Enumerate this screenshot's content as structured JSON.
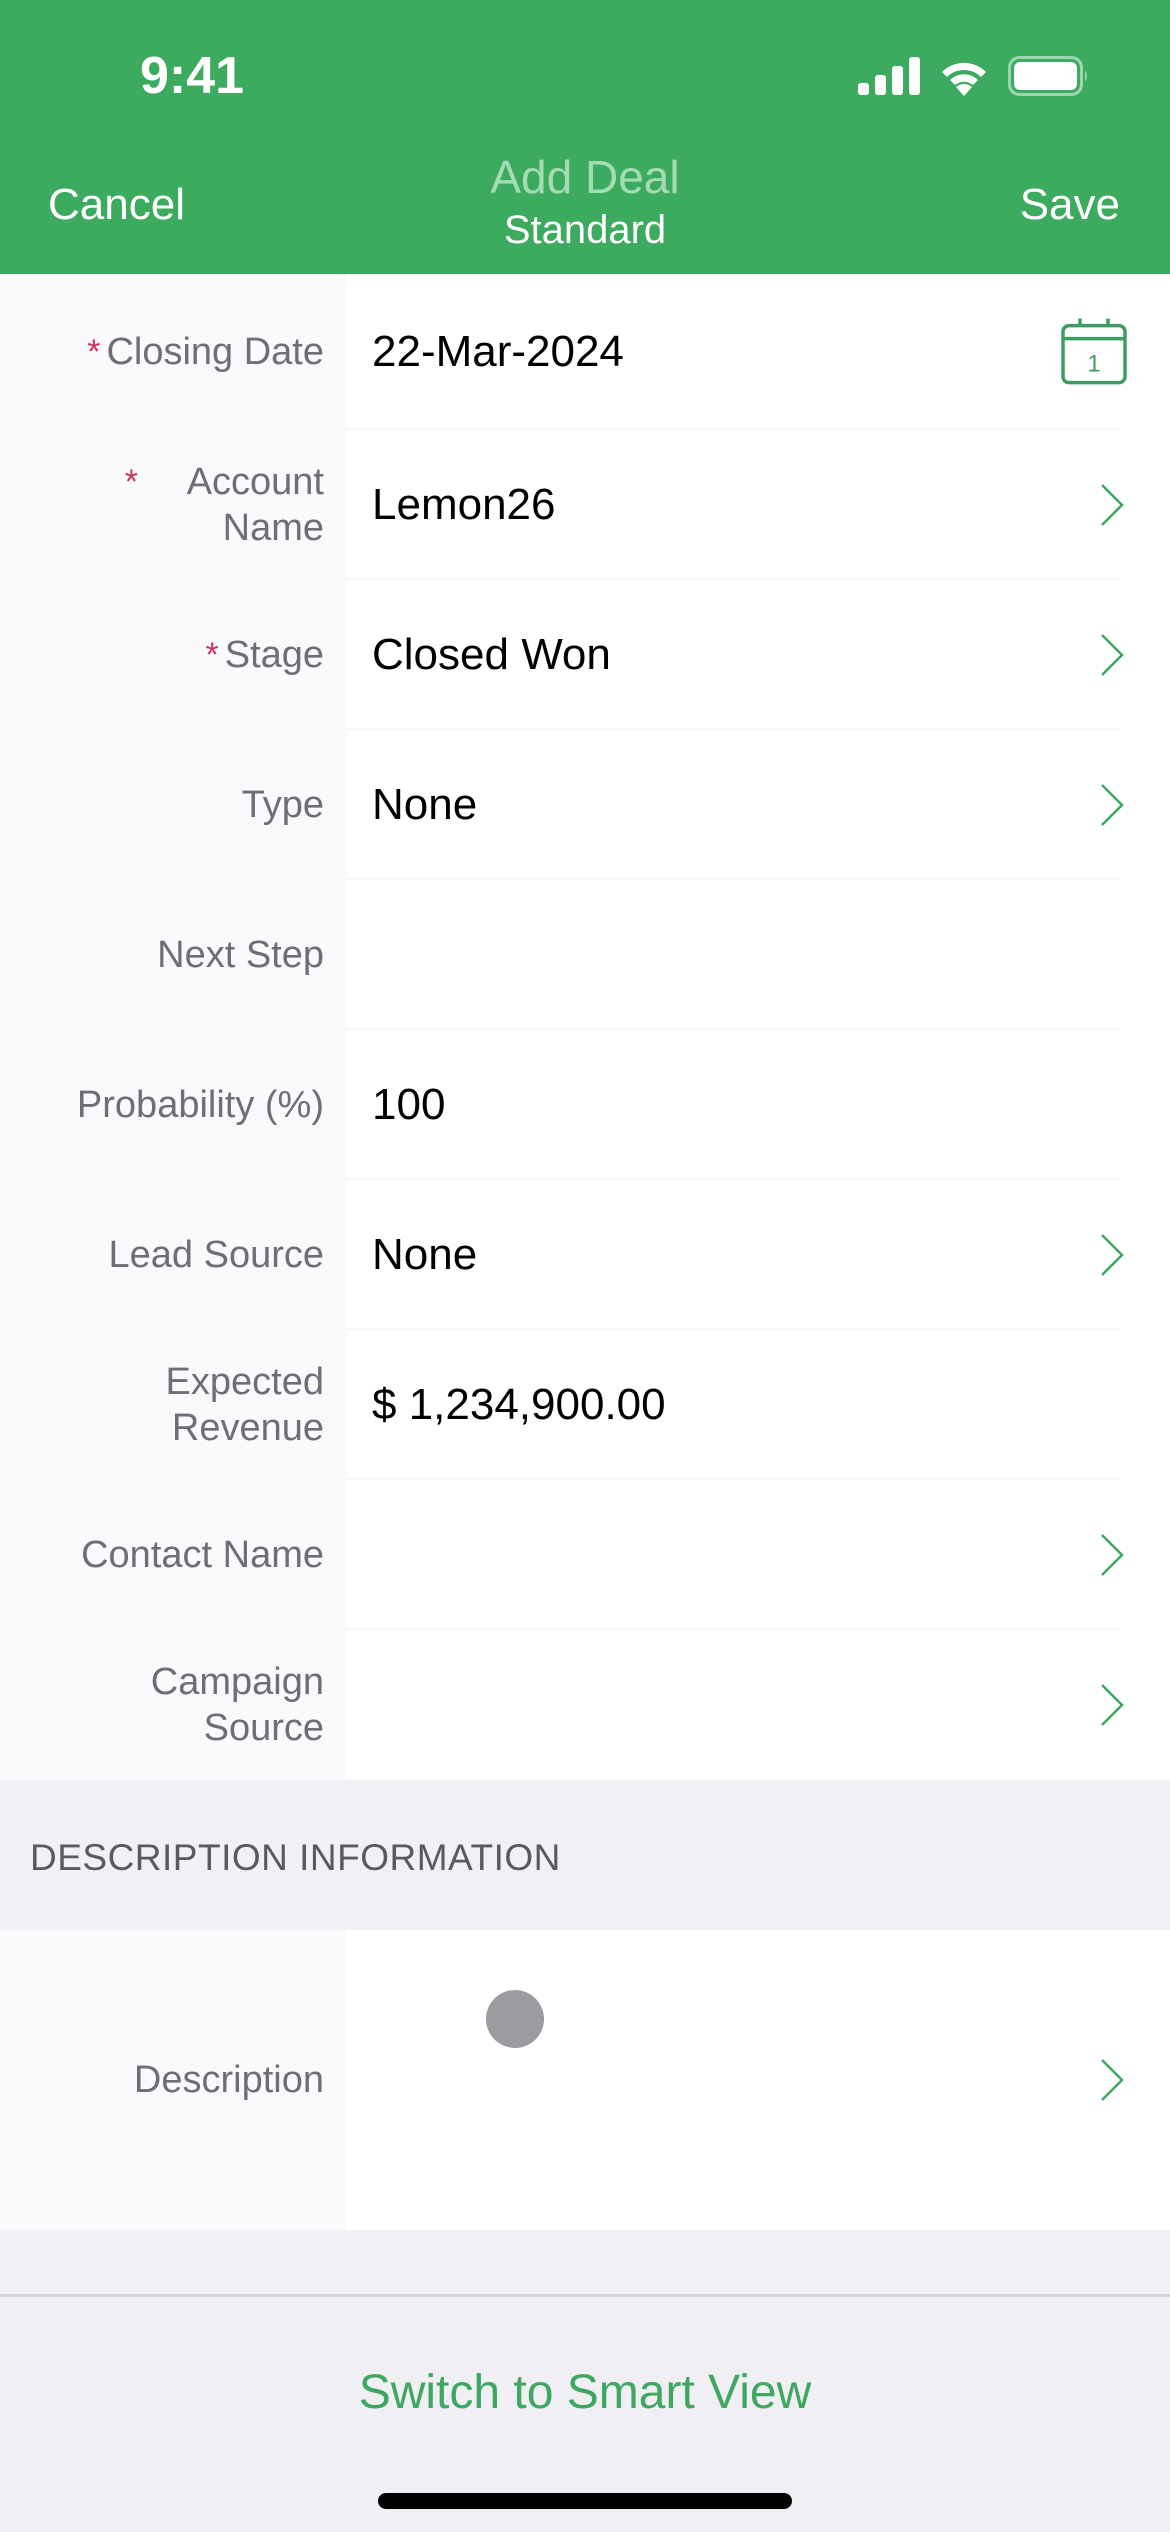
{
  "status_bar": {
    "time": "9:41",
    "icons": [
      "cellular-signal-icon",
      "wifi-icon",
      "battery-icon"
    ]
  },
  "nav": {
    "cancel_label": "Cancel",
    "title": "Add Deal",
    "subtitle": "Standard",
    "save_label": "Save"
  },
  "colors": {
    "brand_green": "#3dab5f",
    "required_asterisk": "#d0335a",
    "chevron": "#3ea760"
  },
  "fields": [
    {
      "label": "Closing Date",
      "required": true,
      "value": "22-Mar-2024",
      "accessory": "calendar-icon",
      "calendar_day": "1"
    },
    {
      "label": "Account Name",
      "required": true,
      "value": "Lemon26",
      "accessory": "chevron-right-icon"
    },
    {
      "label": "Stage",
      "required": true,
      "value": "Closed Won",
      "accessory": "chevron-right-icon"
    },
    {
      "label": "Type",
      "required": false,
      "value": "None",
      "accessory": "chevron-right-icon"
    },
    {
      "label": "Next Step",
      "required": false,
      "value": "",
      "accessory": ""
    },
    {
      "label": "Probability (%)",
      "required": false,
      "value": "100",
      "accessory": ""
    },
    {
      "label": "Lead Source",
      "required": false,
      "value": "None",
      "accessory": "chevron-right-icon"
    },
    {
      "label": "Expected Revenue",
      "required": false,
      "value": "$ 1,234,900.00",
      "accessory": "",
      "read_only": true
    },
    {
      "label": "Contact Name",
      "required": false,
      "value": "",
      "accessory": "chevron-right-icon"
    },
    {
      "label": "Campaign Source",
      "required": false,
      "value": "",
      "accessory": "chevron-right-icon"
    }
  ],
  "sections": [
    {
      "title": "DESCRIPTION INFORMATION",
      "fields": [
        {
          "label": "Description",
          "value": "",
          "accessory": "chevron-right-icon"
        }
      ]
    }
  ],
  "required_marker": "*",
  "footer": {
    "switch_label": "Switch to Smart View"
  }
}
